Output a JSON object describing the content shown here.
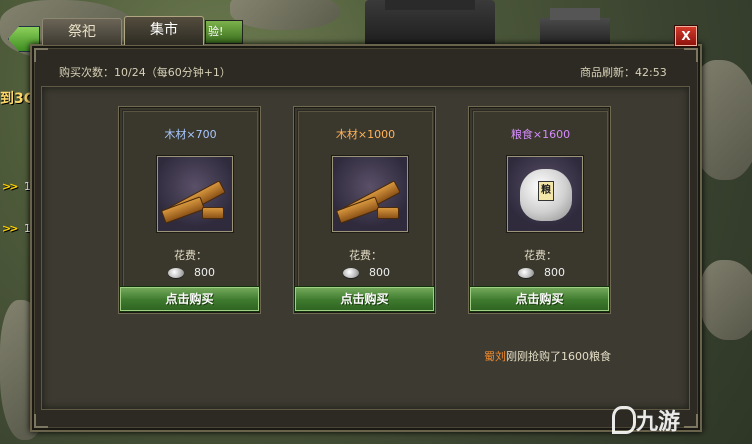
{
  "background": {
    "left_text": "到3C",
    "quest_arrows": [
      {
        "arrow": ">>",
        "count": "1"
      },
      {
        "arrow": ">>",
        "count": "1"
      }
    ],
    "top_tab_fragment": "验!"
  },
  "tabs": [
    {
      "label": "祭祀",
      "active": false
    },
    {
      "label": "集市",
      "active": true
    }
  ],
  "close_label": "X",
  "purchase_info": "购买次数：10/24（每60分钟+1）",
  "refresh_info": "商品刷新：42:53",
  "items": [
    {
      "name": "木材×700",
      "name_color": "#a8c8ff",
      "image": "wood-icon",
      "cost_label": "花费：",
      "cost": "800",
      "buy_label": "点击购买"
    },
    {
      "name": "木材×1000",
      "name_color": "#ffb35a",
      "image": "wood-icon",
      "cost_label": "花费：",
      "cost": "800",
      "buy_label": "点击购买"
    },
    {
      "name": "粮食×1600",
      "name_color": "#d58cff",
      "image": "grain-bag-icon",
      "image_label": "粮",
      "cost_label": "花费：",
      "cost": "800",
      "buy_label": "点击购买"
    }
  ],
  "notice": {
    "who": "蜀",
    "who2": "刘",
    "text": "刚刚抢购了1600粮食"
  },
  "watermark": "九游"
}
